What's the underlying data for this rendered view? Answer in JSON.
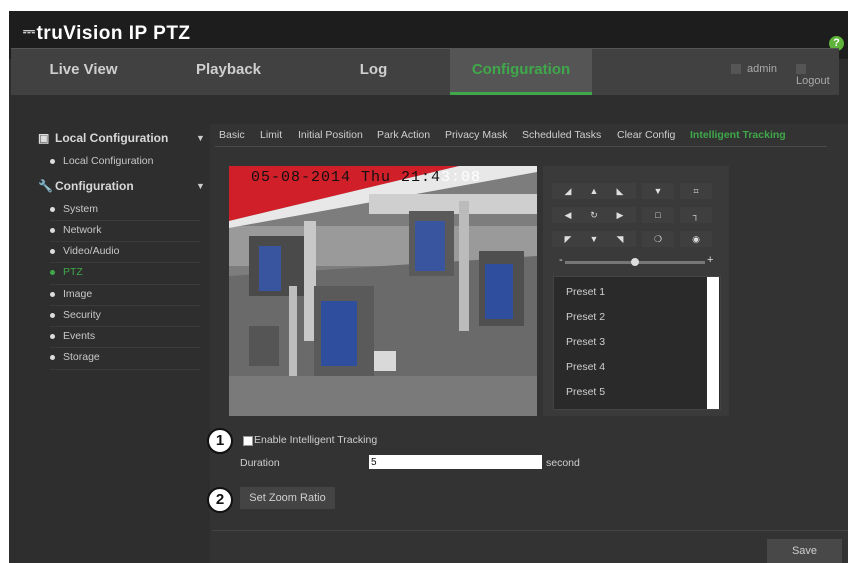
{
  "app": {
    "brand": "truVision IP PTZ",
    "help_icon": "?"
  },
  "nav": {
    "items": [
      {
        "label": "Live View",
        "active": false
      },
      {
        "label": "Playback",
        "active": false
      },
      {
        "label": "Log",
        "active": false
      },
      {
        "label": "Configuration",
        "active": true
      }
    ],
    "user": "admin",
    "logout": "Logout"
  },
  "sidebar": {
    "sections": [
      {
        "title": "Local Configuration",
        "icon": "monitor-gear-icon",
        "items": [
          {
            "label": "Local Configuration"
          }
        ]
      },
      {
        "title": "Configuration",
        "icon": "wrench-icon",
        "items": [
          {
            "label": "System"
          },
          {
            "label": "Network"
          },
          {
            "label": "Video/Audio"
          },
          {
            "label": "PTZ",
            "active": true
          },
          {
            "label": "Image"
          },
          {
            "label": "Security"
          },
          {
            "label": "Events"
          },
          {
            "label": "Storage"
          }
        ]
      }
    ]
  },
  "tabs": [
    "Basic",
    "Limit",
    "Initial Position",
    "Park Action",
    "Privacy Mask",
    "Scheduled Tasks",
    "Clear Config",
    "Intelligent Tracking"
  ],
  "active_tab": "Intelligent Tracking",
  "video": {
    "timestamp_left": "05-08-2014 Thu 21:4",
    "timestamp_right": "3:08"
  },
  "ptz": {
    "slider_minus": "-",
    "slider_plus": "+",
    "presets": [
      "Preset 1",
      "Preset 2",
      "Preset 3",
      "Preset 4",
      "Preset 5"
    ]
  },
  "tracking": {
    "callout_1": "1",
    "callout_2": "2",
    "enable_label": "Enable Intelligent Tracking",
    "enabled": false,
    "duration_label": "Duration",
    "duration_value": "5",
    "duration_unit": "second",
    "zoom_button": "Set Zoom Ratio"
  },
  "save_label": "Save",
  "colors": {
    "accent": "#3fa84a",
    "background": "#2e2e2e",
    "topbar": "#1d1d1d"
  }
}
